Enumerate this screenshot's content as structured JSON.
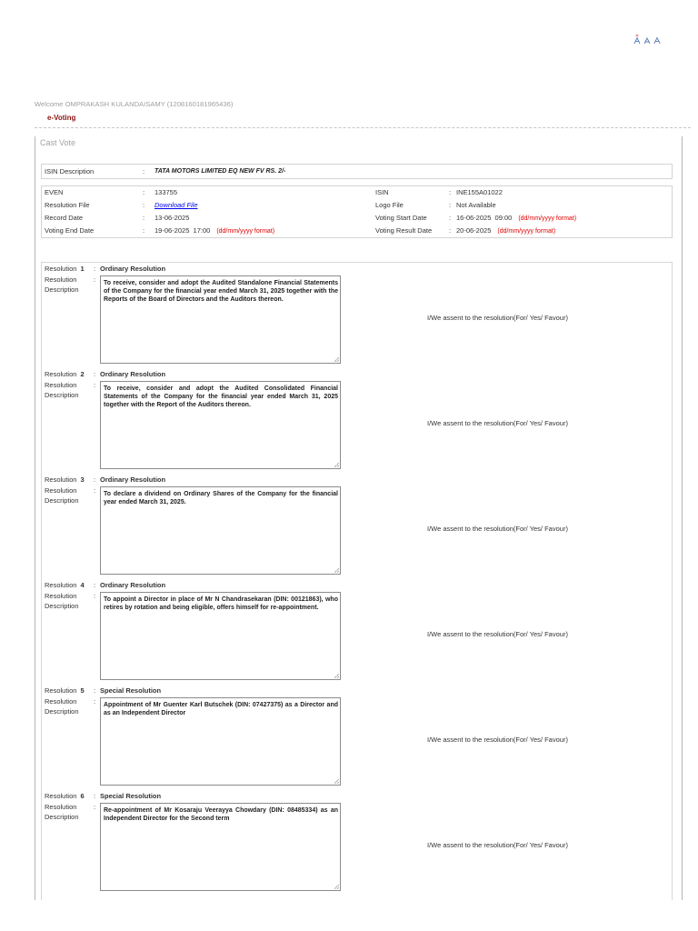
{
  "header": {
    "icons": [
      "text-size-decrease-icon",
      "text-size-reset-icon",
      "text-size-increase-icon"
    ],
    "welcome": "Welcome OMPRAKASH KULANDAISAMY (1208160181965436)",
    "section_title": "e-Voting"
  },
  "page_title": "Cast Vote",
  "colon": ":",
  "isin_description": {
    "label": "ISIN Description",
    "value": "TATA MOTORS LIMITED EQ NEW FV RS. 2/-"
  },
  "details": {
    "even": {
      "label": "EVEN",
      "value": "133755"
    },
    "resolution_file": {
      "label": "Resolution File",
      "value": "Download File"
    },
    "record_date": {
      "label": "Record Date",
      "value": "13-06-2025"
    },
    "voting_end_date": {
      "label": "Voting End Date",
      "value": "19-06-2025  17:00",
      "note": "(dd/mm/yyyy format)"
    },
    "isin": {
      "label": "ISIN",
      "value": "INE155A01022"
    },
    "logo_file": {
      "label": "Logo File",
      "value": "Not Available"
    },
    "voting_start_date": {
      "label": "Voting Start Date",
      "value": "16-06-2025  09:00",
      "note": "(dd/mm/yyyy format)"
    },
    "voting_result_date": {
      "label": "Voting Result Date",
      "value": "20-06-2025",
      "note": "(dd/mm/yyyy format)"
    }
  },
  "labels": {
    "resolution": "Resolution",
    "resolution_description": "Resolution Description",
    "assent": "I/We assent to the resolution(For/ Yes/ Favour)"
  },
  "resolutions": [
    {
      "number": "1",
      "type": "Ordinary Resolution",
      "text": "To receive, consider and adopt the Audited Standalone Financial Statements of the Company for the financial year ended March 31, 2025 together with the Reports of the Board of Directors and the Auditors thereon."
    },
    {
      "number": "2",
      "type": "Ordinary Resolution",
      "text": "To receive, consider and adopt the Audited Consolidated Financial Statements of the Company for the financial year ended March 31, 2025 together with the Report of the Auditors thereon."
    },
    {
      "number": "3",
      "type": "Ordinary Resolution",
      "text": "To declare a dividend on Ordinary Shares of the Company for the financial year ended March 31, 2025."
    },
    {
      "number": "4",
      "type": "Ordinary Resolution",
      "text": "To appoint a Director in place of Mr N Chandrasekaran (DIN: 00121863), who retires by rotation and being eligible, offers himself for re-appointment."
    },
    {
      "number": "5",
      "type": "Special Resolution",
      "text": "Appointment of Mr Guenter Karl Butschek (DIN: 07427375) as a Director and as an Independent Director"
    },
    {
      "number": "6",
      "type": "Special Resolution",
      "text": "Re-appointment of Mr Kosaraju Veerayya Chowdary (DIN: 08485334) as an Independent Director for the Second term"
    }
  ],
  "colors": {
    "section_title": "#8b1414",
    "date_format_note": "#e00000",
    "link": "#0000ee",
    "icon": "#5b7cb8",
    "icon_accent": "#d83a3a"
  }
}
